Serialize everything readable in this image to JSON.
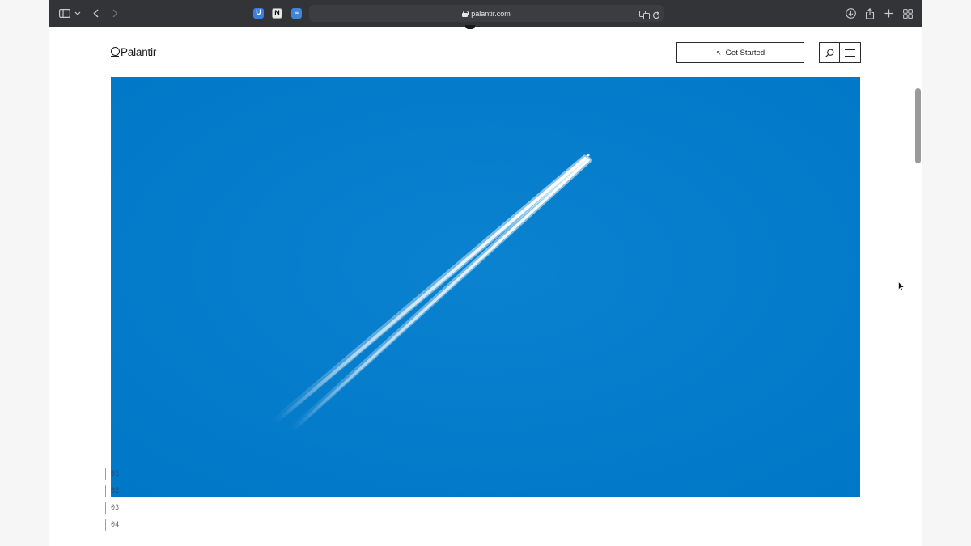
{
  "browser": {
    "url": "palantir.com",
    "extensions": [
      {
        "name": "bitwarden",
        "glyph": "U"
      },
      {
        "name": "notion",
        "glyph": "N"
      },
      {
        "name": "notes",
        "glyph": "≡"
      }
    ]
  },
  "site": {
    "logo_text": "Palantir",
    "cta_label": "Get Started",
    "cta_icon": "↖"
  },
  "hero": {
    "description_colors": {
      "sky": "#007bc9",
      "contrail": "#ffffff"
    }
  },
  "slides": [
    {
      "label": "01"
    },
    {
      "label": "02"
    },
    {
      "label": "03"
    },
    {
      "label": "04"
    }
  ]
}
